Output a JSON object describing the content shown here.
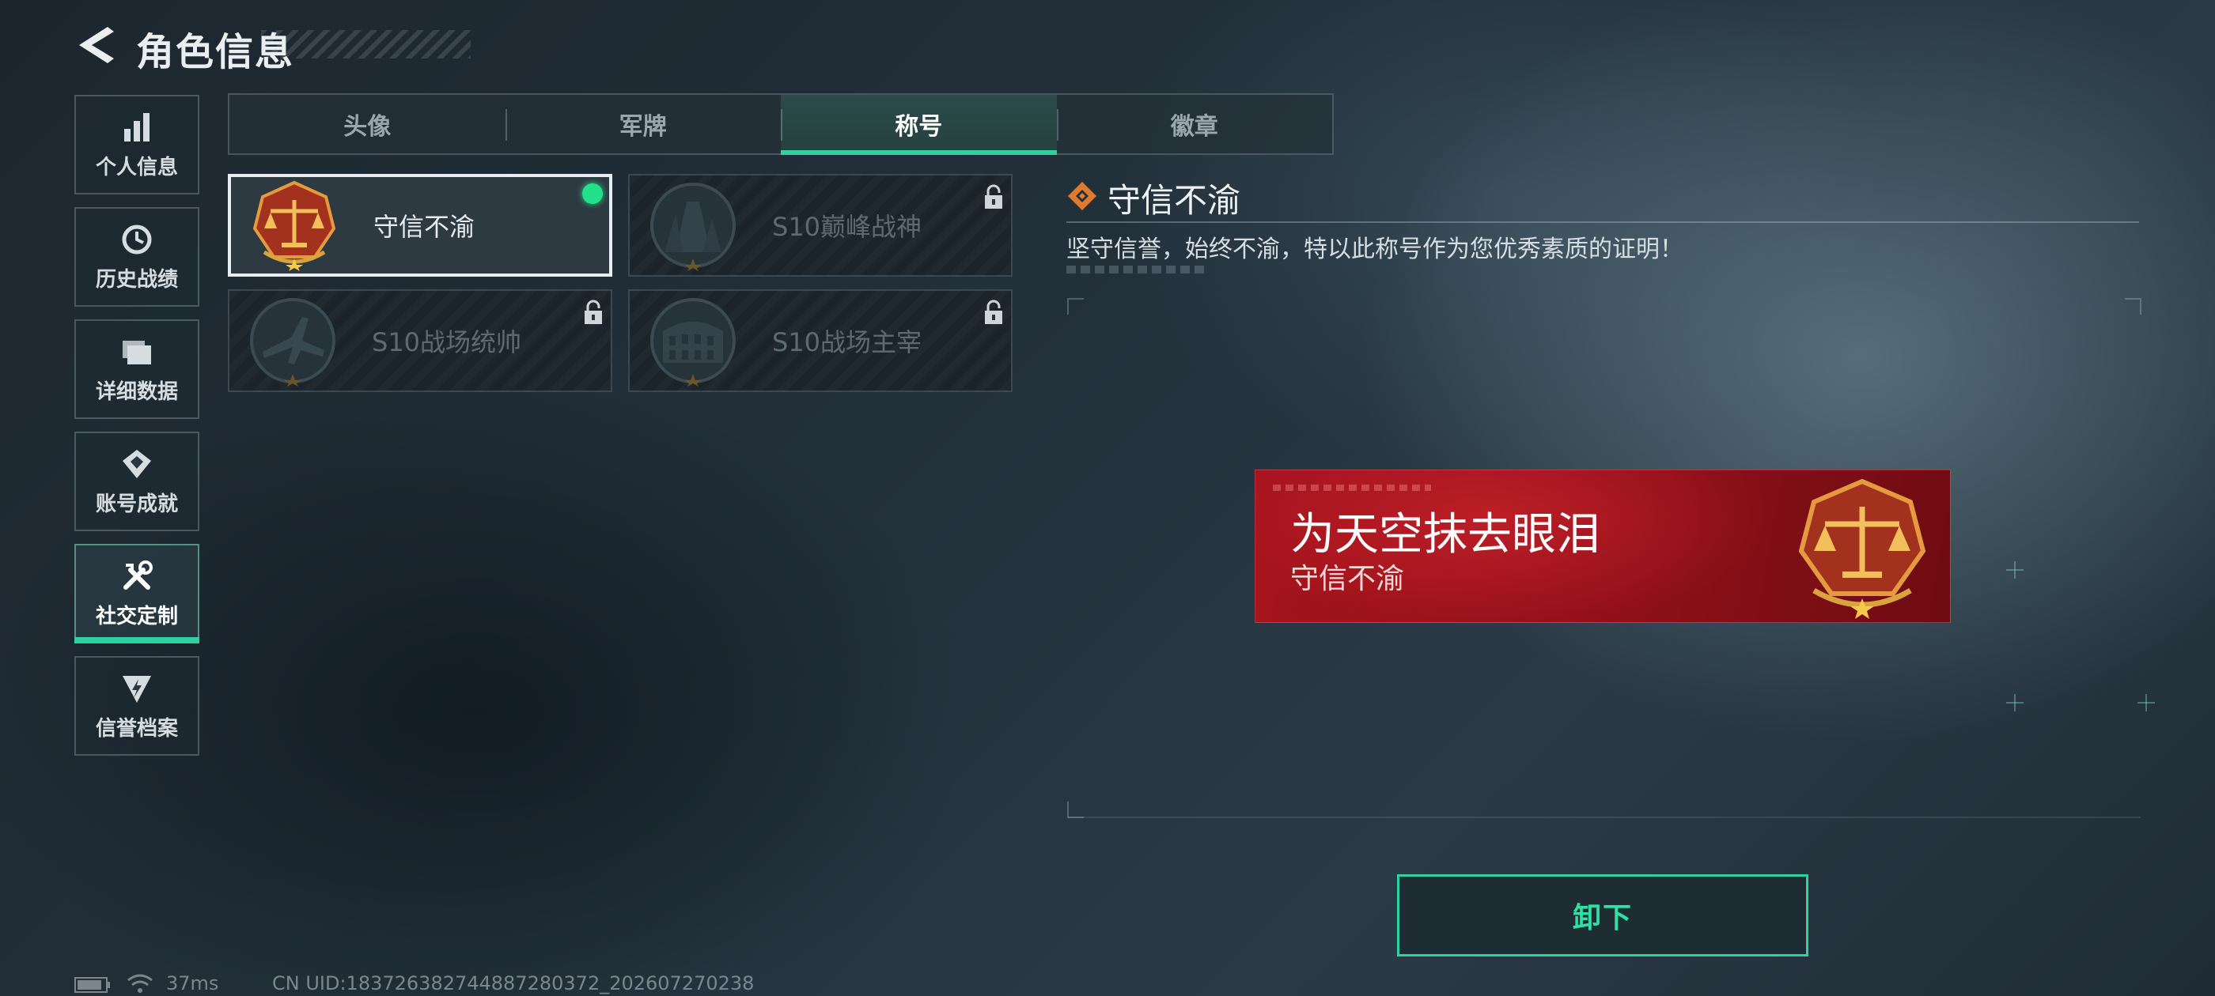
{
  "header": {
    "title": "角色信息"
  },
  "sidebar": {
    "items": [
      {
        "label": "个人信息",
        "icon": "bar-chart-icon",
        "active": false
      },
      {
        "label": "历史战绩",
        "icon": "history-clock-icon",
        "active": false
      },
      {
        "label": "详细数据",
        "icon": "folder-stack-icon",
        "active": false
      },
      {
        "label": "账号成就",
        "icon": "achievement-diamond-icon",
        "active": false
      },
      {
        "label": "社交定制",
        "icon": "tools-icon",
        "active": true
      },
      {
        "label": "信誉档案",
        "icon": "shield-bolt-icon",
        "active": false
      }
    ]
  },
  "tabs": [
    {
      "label": "头像",
      "active": false
    },
    {
      "label": "军牌",
      "active": false
    },
    {
      "label": "称号",
      "active": true
    },
    {
      "label": "徽章",
      "active": false
    }
  ],
  "titles": [
    {
      "name": "守信不渝",
      "state": "equipped",
      "icon": "scales-emblem-icon"
    },
    {
      "name": "S10巅峰战神",
      "state": "locked",
      "icon": "tower-emblem-icon"
    },
    {
      "name": "S10战场统帅",
      "state": "locked",
      "icon": "jet-emblem-icon"
    },
    {
      "name": "S10战场主宰",
      "state": "locked",
      "icon": "colosseum-emblem-icon"
    }
  ],
  "detail": {
    "title": "守信不渝",
    "description": "坚守信誉，始终不渝，特以此称号作为您优秀素质的证明！",
    "banner": {
      "player_name": "为天空抹去眼泪",
      "title": "守信不渝"
    },
    "action_label": "卸下"
  },
  "status": {
    "ping": "37ms",
    "uid": "CN UID:183726382744887280372_202607270238"
  },
  "colors": {
    "accent": "#2fd1a0",
    "banner": "#a5141d",
    "equipped_dot": "#23e08a",
    "emblem_orange": "#e07a2e"
  }
}
